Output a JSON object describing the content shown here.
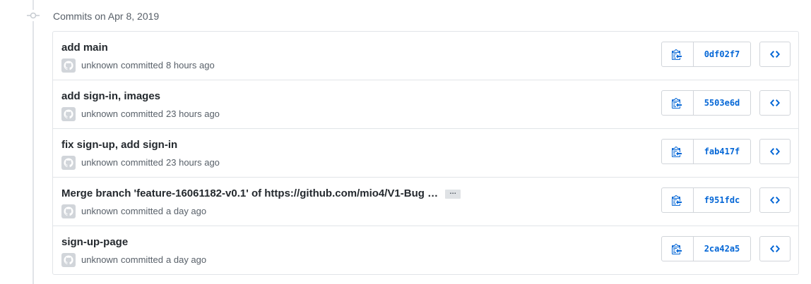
{
  "group_header": "Commits on Apr 8, 2019",
  "colors": {
    "link": "#0366d6",
    "muted": "#586069",
    "border": "#e1e4e8"
  },
  "commits": [
    {
      "title": "add main",
      "author": "unknown",
      "verb": "committed",
      "when": "8 hours ago",
      "sha": "0df02f7",
      "has_ellipsis": false
    },
    {
      "title": "add sign-in, images",
      "author": "unknown",
      "verb": "committed",
      "when": "23 hours ago",
      "sha": "5503e6d",
      "has_ellipsis": false
    },
    {
      "title": "fix sign-up, add sign-in",
      "author": "unknown",
      "verb": "committed",
      "when": "23 hours ago",
      "sha": "fab417f",
      "has_ellipsis": false
    },
    {
      "title": "Merge branch 'feature-16061182-v0.1' of https://github.com/mio4/V1-Bug …",
      "author": "unknown",
      "verb": "committed",
      "when": "a day ago",
      "sha": "f951fdc",
      "has_ellipsis": true,
      "ellipsis_label": "…"
    },
    {
      "title": "sign-up-page",
      "author": "unknown",
      "verb": "committed",
      "when": "a day ago",
      "sha": "2ca42a5",
      "has_ellipsis": false
    }
  ],
  "icons": {
    "timeline": "git-commit-icon",
    "avatar": "github-avatar-icon",
    "copy": "clippy-icon",
    "browse": "code-icon"
  }
}
